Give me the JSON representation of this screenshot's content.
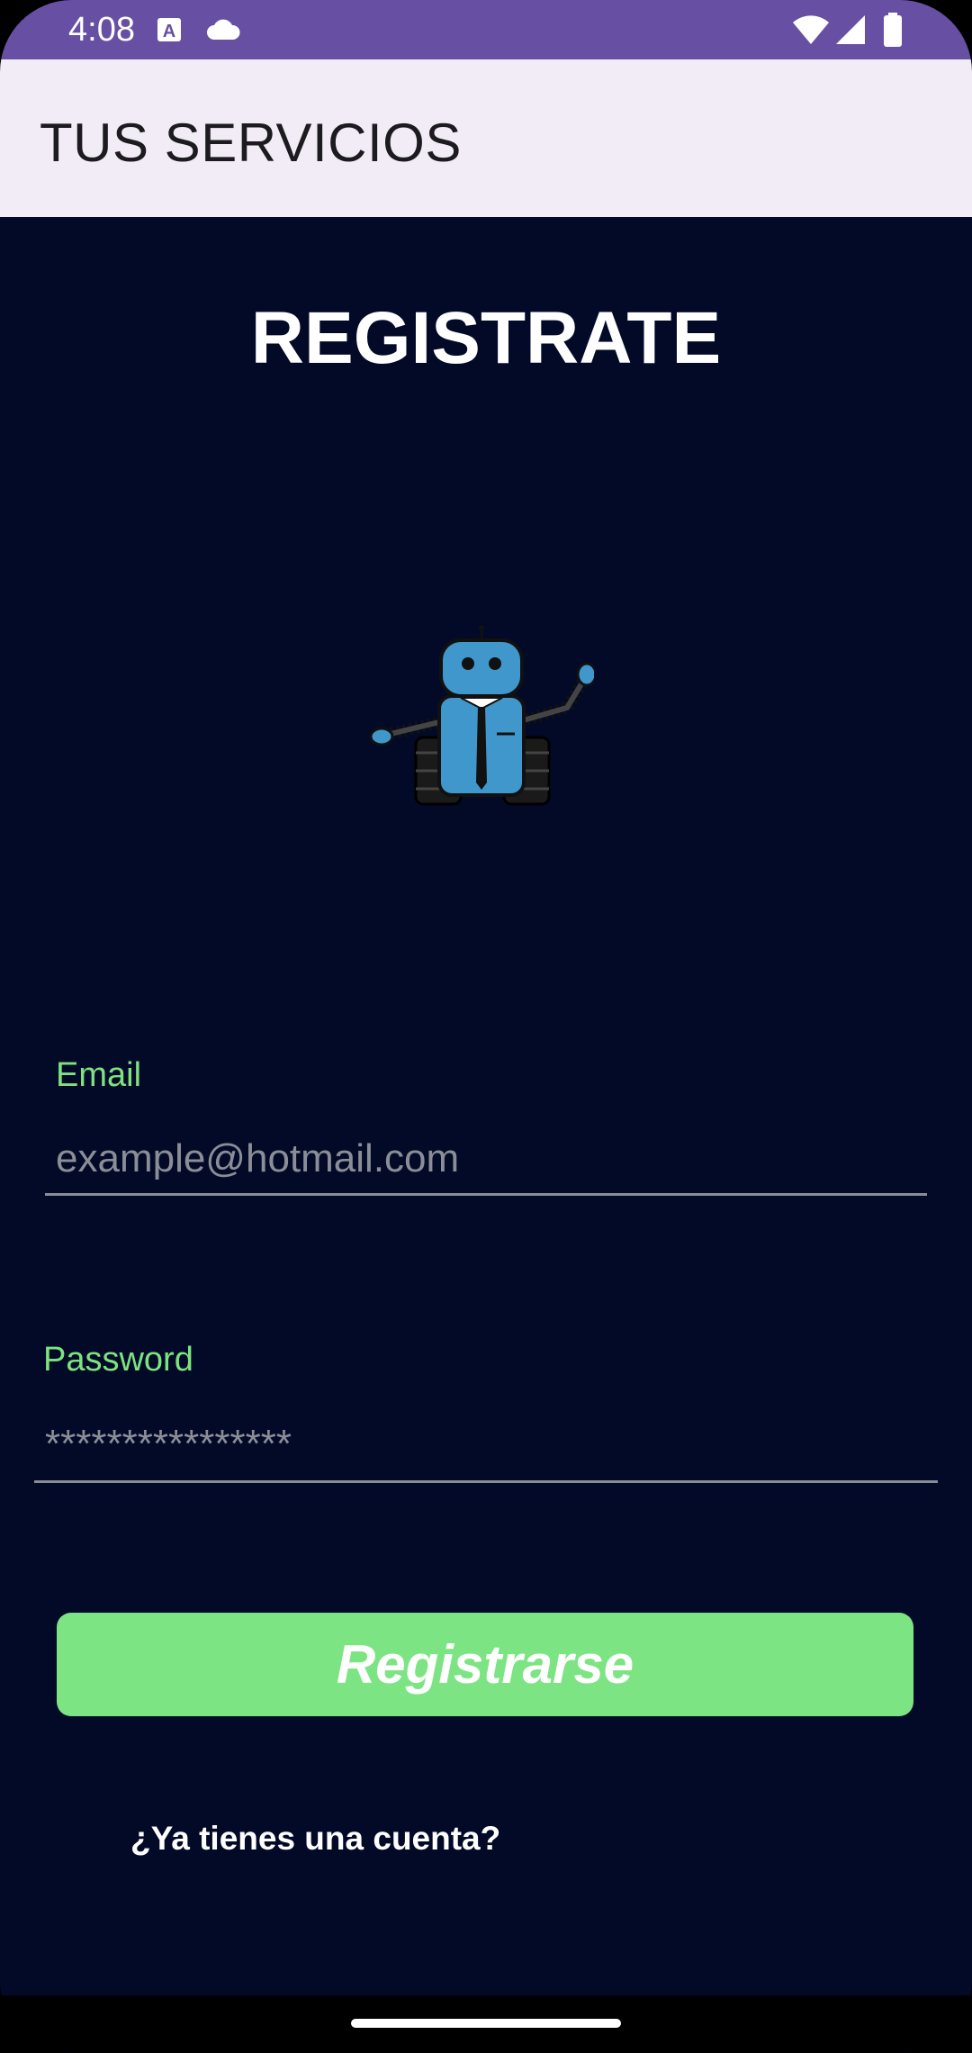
{
  "status_bar": {
    "time": "4:08",
    "icons": [
      "a-notification-icon",
      "cloud-icon",
      "wifi-icon",
      "signal-icon",
      "battery-icon"
    ],
    "background": "#6750a4"
  },
  "app_bar": {
    "title": "TUS SERVICIOS",
    "background": "#f2ecf6"
  },
  "main": {
    "heading": "REGISTRATE",
    "logo": "robot-mascot-icon",
    "background": "#020a28",
    "email": {
      "label": "Email",
      "placeholder": "example@hotmail.com",
      "value": ""
    },
    "password": {
      "label": "Password",
      "placeholder": "****************",
      "value": ""
    },
    "register_label": "Registrarse",
    "login_link": "¿Ya tienes una cuenta?",
    "accent": "#7de483"
  }
}
